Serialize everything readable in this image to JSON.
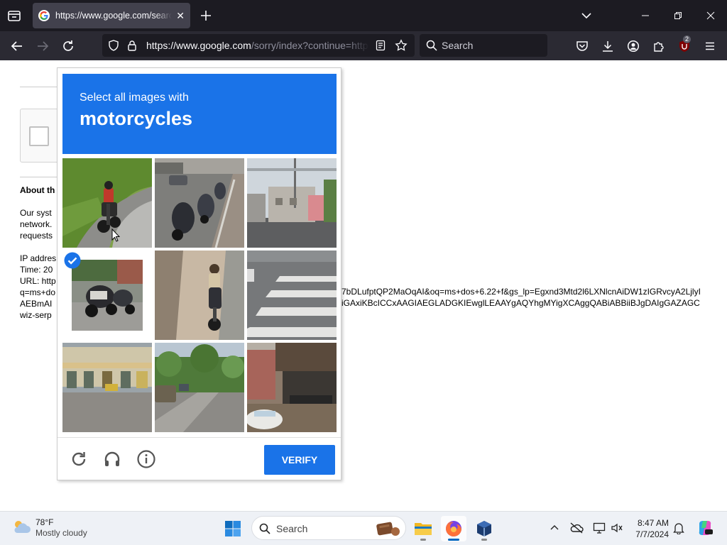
{
  "browser": {
    "tab_title": "https://www.google.com/search?q=ms+dos",
    "url_host": "https://www.google.com",
    "url_path": "/sorry/index?continue=https://www.google.com",
    "search_placeholder": "Search",
    "extension_badge": "2"
  },
  "page": {
    "about_heading": "About th",
    "para_lines": [
      "Our syst",
      "network.",
      "requests"
    ],
    "ip_lines": [
      "IP addres",
      "Time: 20",
      "URL: http",
      "q=ms+do",
      "AEBmAI",
      "wiz-serp"
    ],
    "url_right_1": "7bDLufptQP2MaOqAI&oq=ms+dos+6.22+f&gs_lp=Egxnd3Mtd2l6LXNlcnAiDW1zIGRvcyA2LjlyI",
    "url_right_2": "iGAxiKBcICCxAAGIAEGLADGKIEwglLEAAYgAQYhgMYigXCAggQABiABBiiBJgDAIgGAZAGC"
  },
  "captcha": {
    "instruction": "Select all images with",
    "target": "motorcycles",
    "verify_label": "VERIFY",
    "brand_color": "#1a73e8",
    "tiles": [
      {
        "label": "tile-1",
        "selected": false
      },
      {
        "label": "tile-2",
        "selected": false
      },
      {
        "label": "tile-3",
        "selected": false
      },
      {
        "label": "tile-4",
        "selected": true
      },
      {
        "label": "tile-5",
        "selected": false
      },
      {
        "label": "tile-6",
        "selected": false
      },
      {
        "label": "tile-7",
        "selected": false
      },
      {
        "label": "tile-8",
        "selected": false
      },
      {
        "label": "tile-9",
        "selected": false
      }
    ]
  },
  "taskbar": {
    "weather_temp": "78°F",
    "weather_desc": "Mostly cloudy",
    "search_placeholder": "Search",
    "time": "8:47 AM",
    "date": "7/7/2024"
  }
}
